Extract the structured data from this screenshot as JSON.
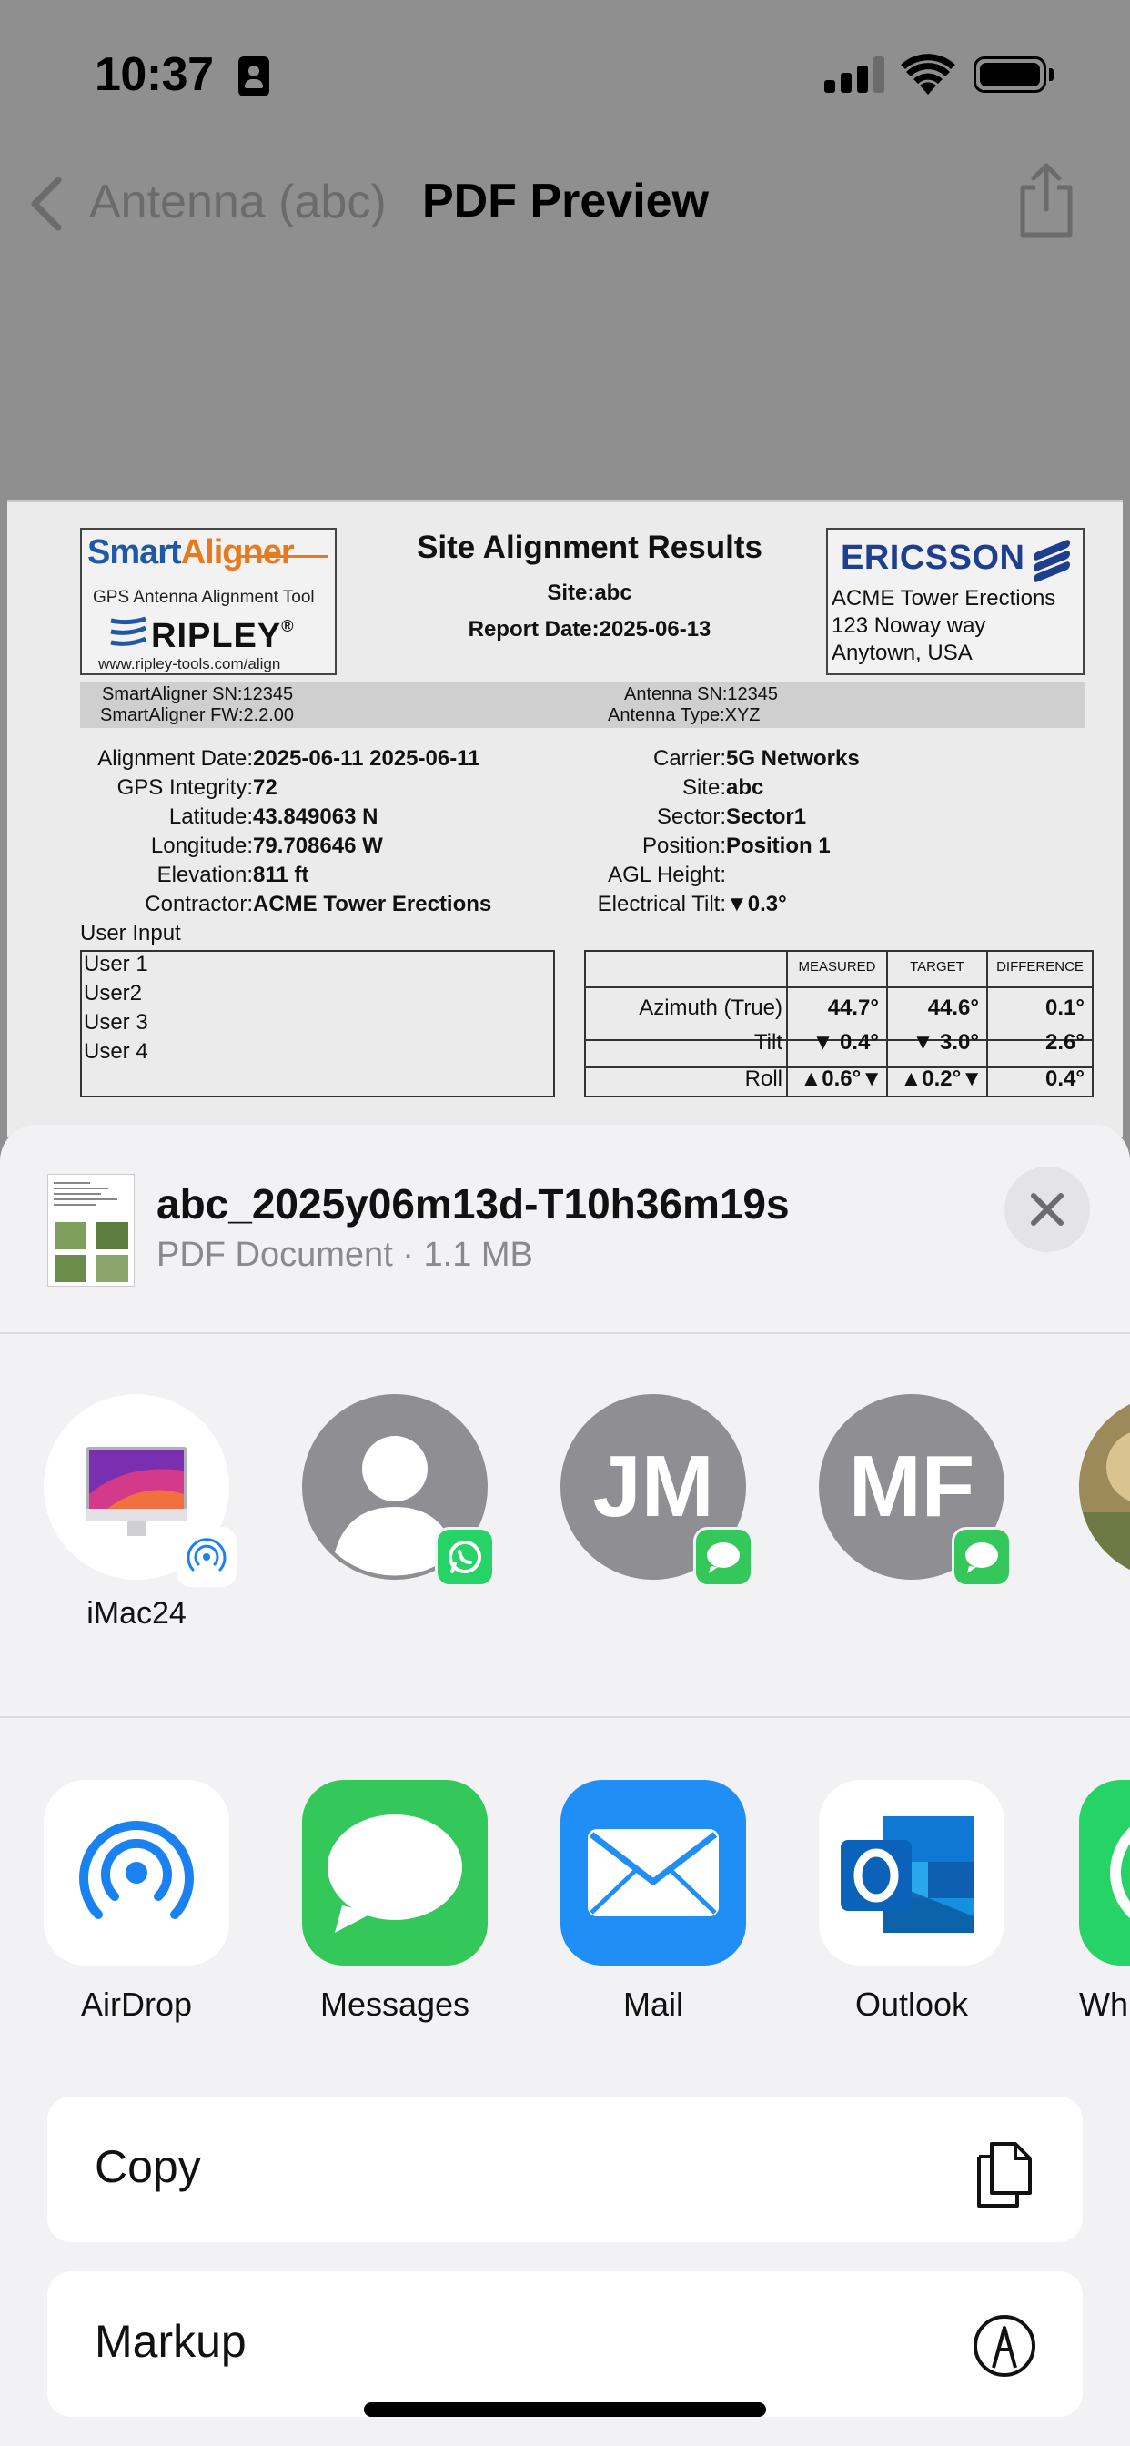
{
  "status_bar": {
    "time": "10:37"
  },
  "nav": {
    "back_label": "Antenna (abc)",
    "title": "PDF Preview"
  },
  "pdf": {
    "logo": {
      "smart": "Smart",
      "aligner": "Aligner",
      "tagline": "GPS Antenna Alignment Tool",
      "ripley": "RIPLEY",
      "reg": "®",
      "url": "www.ripley-tools.com/align"
    },
    "title": "Site Alignment Results",
    "site": "Site:abc",
    "report_date": "Report Date:2025-06-13",
    "company": {
      "logo": "ERICSSON",
      "name": "ACME Tower Erections",
      "address1": "123 Noway way",
      "address2": "Anytown, USA"
    },
    "sn_bar": {
      "aligner_sn": "SmartAligner SN:12345",
      "aligner_fw": "SmartAligner FW:2.2.00",
      "antenna_sn": "Antenna SN:12345",
      "antenna_type": "Antenna Type:XYZ"
    },
    "left_info": [
      {
        "label": "Alignment Date:",
        "value": "2025-06-11 2025-06-11"
      },
      {
        "label": "GPS Integrity:",
        "value": "72"
      },
      {
        "label": "Latitude:",
        "value": "43.849063 N"
      },
      {
        "label": "Longitude:",
        "value": "79.708646 W"
      },
      {
        "label": "Elevation:",
        "value": "811 ft"
      },
      {
        "label": "Contractor:",
        "value": "ACME Tower Erections"
      }
    ],
    "right_info": [
      {
        "label": "Carrier:",
        "value": "5G Networks"
      },
      {
        "label": "Site:",
        "value": "abc"
      },
      {
        "label": "Sector:",
        "value": "Sector1"
      },
      {
        "label": "Position:",
        "value": "Position 1"
      },
      {
        "label": "AGL Height:",
        "value": ""
      },
      {
        "label": "Electrical Tilt:",
        "value": "▼0.3°"
      }
    ],
    "user_input_label": "User Input",
    "users": [
      "User 1",
      "User2",
      "User 3",
      "User 4"
    ],
    "table": {
      "headers": [
        "MEASURED",
        "TARGET",
        "DIFFERENCE"
      ],
      "rows": [
        {
          "label": "Azimuth (True)",
          "measured": "44.7°",
          "target": "44.6°",
          "difference": "0.1°"
        },
        {
          "label": "Tilt",
          "measured": "▼ 0.4°",
          "target": "▼ 3.0°",
          "difference": "2.6°"
        },
        {
          "label": "Roll",
          "measured": "▲0.6°▼",
          "target": "▲0.2°▼",
          "difference": "0.4°"
        }
      ]
    }
  },
  "share_sheet": {
    "file_name": "abc_2025y06m13d-T10h36m19s",
    "file_meta": "PDF Document · 1.1 MB",
    "people": [
      {
        "label": "iMac24",
        "badge": "airdrop-badge-icon"
      },
      {
        "label": "",
        "badge": "whatsapp-badge-icon"
      },
      {
        "label": "",
        "initials": "JM",
        "badge": "messages-badge-icon"
      },
      {
        "label": "",
        "initials": "MF",
        "badge": "messages-badge-icon"
      }
    ],
    "apps": [
      {
        "label": "AirDrop",
        "icon": "airdrop-icon"
      },
      {
        "label": "Messages",
        "icon": "messages-icon"
      },
      {
        "label": "Mail",
        "icon": "mail-icon"
      },
      {
        "label": "Outlook",
        "icon": "outlook-icon"
      },
      {
        "label": "Wh",
        "icon": "whatsapp-icon"
      }
    ],
    "actions": [
      {
        "label": "Copy",
        "icon": "copy-icon"
      },
      {
        "label": "Markup",
        "icon": "markup-icon"
      }
    ]
  },
  "colors": {
    "dim_background": "#8f8f8f",
    "sheet_background": "#f2f2f4",
    "messages_green": "#34c759",
    "mail_blue": "#1f8ff5",
    "airdrop_blue": "#1a82f0",
    "whatsapp_green": "#25d366",
    "person_gray": "#8e8e93"
  }
}
